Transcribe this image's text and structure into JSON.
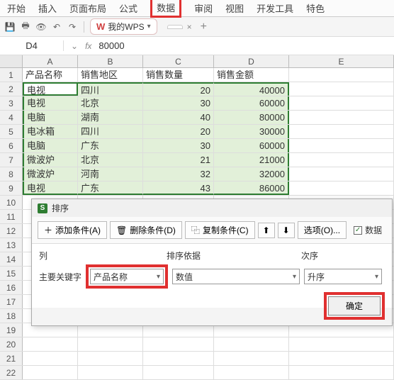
{
  "tabs": [
    "开始",
    "插入",
    "页面布局",
    "公式",
    "数据",
    "审阅",
    "视图",
    "开发工具",
    "特色"
  ],
  "active_tab_index": 4,
  "toolbar": {
    "wps_label": "我的WPS"
  },
  "doc_tab_blank": "",
  "namebox": "D4",
  "formula": "80000",
  "columns": [
    "A",
    "B",
    "C",
    "D",
    "E"
  ],
  "headers": [
    "产品名称",
    "销售地区",
    "销售数量",
    "销售金额"
  ],
  "rows": [
    {
      "n": "1"
    },
    {
      "n": "2",
      "a": "电视",
      "b": "四川",
      "c": "20",
      "d": "40000"
    },
    {
      "n": "3",
      "a": "电视",
      "b": "北京",
      "c": "30",
      "d": "60000"
    },
    {
      "n": "4",
      "a": "电脑",
      "b": "湖南",
      "c": "40",
      "d": "80000"
    },
    {
      "n": "5",
      "a": "电冰箱",
      "b": "四川",
      "c": "20",
      "d": "30000"
    },
    {
      "n": "6",
      "a": "电脑",
      "b": "广东",
      "c": "30",
      "d": "60000"
    },
    {
      "n": "7",
      "a": "微波炉",
      "b": "北京",
      "c": "21",
      "d": "21000"
    },
    {
      "n": "8",
      "a": "微波炉",
      "b": "河南",
      "c": "32",
      "d": "32000"
    },
    {
      "n": "9",
      "a": "电视",
      "b": "广东",
      "c": "43",
      "d": "86000"
    },
    {
      "n": "10"
    },
    {
      "n": "11"
    },
    {
      "n": "12"
    },
    {
      "n": "13"
    },
    {
      "n": "14"
    },
    {
      "n": "15"
    },
    {
      "n": "16"
    },
    {
      "n": "17"
    },
    {
      "n": "18"
    },
    {
      "n": "19"
    },
    {
      "n": "20"
    },
    {
      "n": "21"
    },
    {
      "n": "22"
    }
  ],
  "dialog": {
    "title": "排序",
    "btn_add": "添加条件(A)",
    "btn_del": "删除条件(D)",
    "btn_copy": "复制条件(C)",
    "btn_opts": "选项(O)...",
    "chk_label": "数据",
    "lbl_col": "列",
    "lbl_basis": "排序依据",
    "lbl_order": "次序",
    "key_label": "主要关键字",
    "combo1": "产品名称",
    "combo2": "数值",
    "combo3": "升序",
    "ok": "确定"
  }
}
